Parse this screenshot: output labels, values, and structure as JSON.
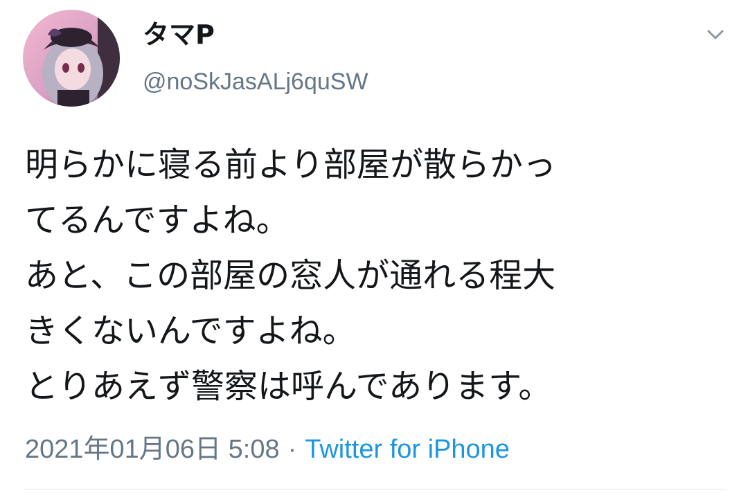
{
  "user": {
    "display_name": "タマP",
    "handle": "@noSkJasALj6quSW"
  },
  "icons": {
    "avatar": "profile-avatar",
    "menu": "chevron-down-icon"
  },
  "tweet": {
    "lines": [
      "明らかに寝る前より部屋が散らかっ",
      "てるんですよね。",
      "あと、この部屋の窓人が通れる程大",
      "きくないんですよね。",
      "とりあえず警察は呼んであります。"
    ]
  },
  "meta": {
    "timestamp": "2021年01月06日 5:08",
    "separator": "·",
    "source": "Twitter for iPhone"
  },
  "colors": {
    "text": "#14171a",
    "secondary": "#657786",
    "link": "#1b95e0",
    "divider": "#e1e8ed"
  }
}
